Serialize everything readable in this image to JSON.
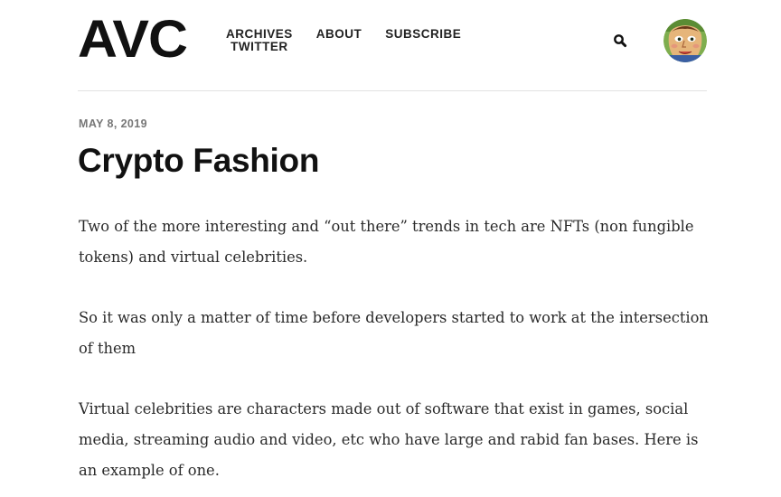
{
  "header": {
    "logo": "AVC",
    "nav": {
      "archives": "ARCHIVES",
      "twitter": "TWITTER",
      "about": "ABOUT",
      "subscribe": "SUBSCRIBE"
    },
    "search_icon": "search-icon",
    "avatar_icon": "avatar"
  },
  "post": {
    "date": "MAY 8, 2019",
    "title": "Crypto Fashion",
    "paragraphs": [
      "Two of the more interesting and “out there” trends in tech are NFTs (non fungible tokens) and virtual celebrities.",
      "So it was only a matter of time before developers started to work at the intersection of them",
      "Virtual celebrities are characters made out of software that exist in games, social media, streaming audio and video, etc who have large and rabid fan bases. Here is an example of one."
    ]
  },
  "colors": {
    "text": "#222222",
    "date": "#777777",
    "divider": "#e2e2e2",
    "background": "#ffffff"
  }
}
